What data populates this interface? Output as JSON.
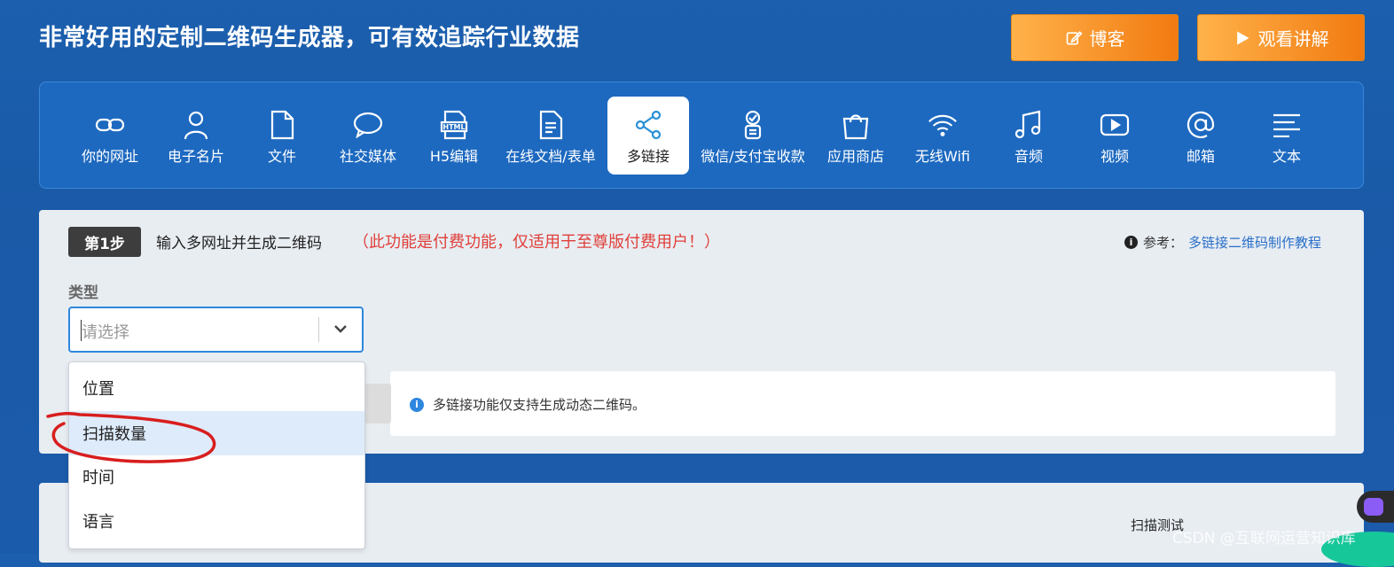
{
  "header": {
    "title": "非常好用的定制二维码生成器，可有效追踪行业数据",
    "blog_label": "博客",
    "watch_label": "观看讲解"
  },
  "toolbar": {
    "items": [
      {
        "label": "你的网址",
        "icon": "link-icon"
      },
      {
        "label": "电子名片",
        "icon": "user-icon"
      },
      {
        "label": "文件",
        "icon": "file-icon"
      },
      {
        "label": "社交媒体",
        "icon": "chat-bubble-icon"
      },
      {
        "label": "H5编辑",
        "icon": "html-icon"
      },
      {
        "label": "在线文档/表单",
        "icon": "document-icon"
      },
      {
        "label": "多链接",
        "icon": "share-icon",
        "active": true
      },
      {
        "label": "微信/支付宝收款",
        "icon": "payment-icon"
      },
      {
        "label": "应用商店",
        "icon": "shopping-bag-icon"
      },
      {
        "label": "无线Wifi",
        "icon": "wifi-icon"
      },
      {
        "label": "音频",
        "icon": "music-icon"
      },
      {
        "label": "视频",
        "icon": "video-icon"
      },
      {
        "label": "邮箱",
        "icon": "at-icon"
      },
      {
        "label": "文本",
        "icon": "text-lines-icon"
      }
    ]
  },
  "step": {
    "badge": "第1步",
    "text": "输入多网址并生成二维码",
    "warning": "（此功能是付费功能，仅适用于至尊版付费用户！）",
    "ref_label": "参考：",
    "ref_link": "多链接二维码制作教程"
  },
  "form": {
    "type_label": "类型",
    "select_placeholder": "请选择",
    "options": [
      "位置",
      "扫描数量",
      "时间",
      "语言"
    ],
    "highlighted_option": "扫描数量"
  },
  "notice": {
    "text": "多链接功能仅支持生成动态二维码。"
  },
  "lower": {
    "scan_test": "扫描测试"
  },
  "watermark": "CSDN @互联网运营知识库",
  "colors": {
    "accent": "#2e86de",
    "warning": "#e0403a",
    "orange": "#f7942b",
    "annotation_red": "#d81e1e"
  }
}
